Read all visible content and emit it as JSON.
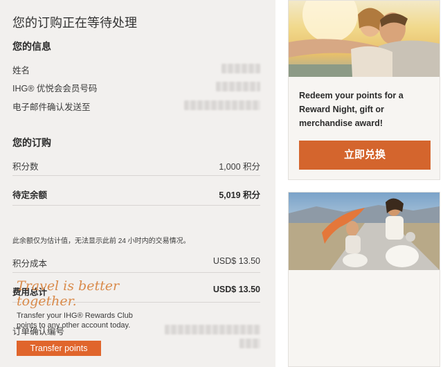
{
  "order": {
    "page_title": "您的订购正在等待处理",
    "info_section_title": "您的信息",
    "info_rows": [
      {
        "label": "姓名"
      },
      {
        "label": "IHG® 优悦会会员号码"
      },
      {
        "label": "电子邮件确认发送至"
      }
    ],
    "purchase_section_title": "您的订购",
    "points_label": "积分数",
    "points_value": "1,000 积分",
    "pending_label": "待定余额",
    "pending_value": "5,019 积分",
    "note": "此余额仅为估计值，无法显示此前 24 小时内的交易情况。",
    "cost_label": "积分成本",
    "cost_value": "USD$ 13.50",
    "total_label": "费用总计",
    "total_value": "USD$ 13.50",
    "confirmation_label": "订单确认编号"
  },
  "promo1": {
    "text": "Redeem your points for a Reward Night, gift or merchandise award!",
    "button_label": "立即兑换"
  },
  "promo2": {
    "title": "Travel is better together.",
    "text": "Transfer your IHG® Rewards Club points to any other account today.",
    "button_label": "Transfer points"
  },
  "colors": {
    "accent": "#d4652d",
    "panel_bg": "#f2f0ee",
    "travel_title": "#d98a4a"
  }
}
